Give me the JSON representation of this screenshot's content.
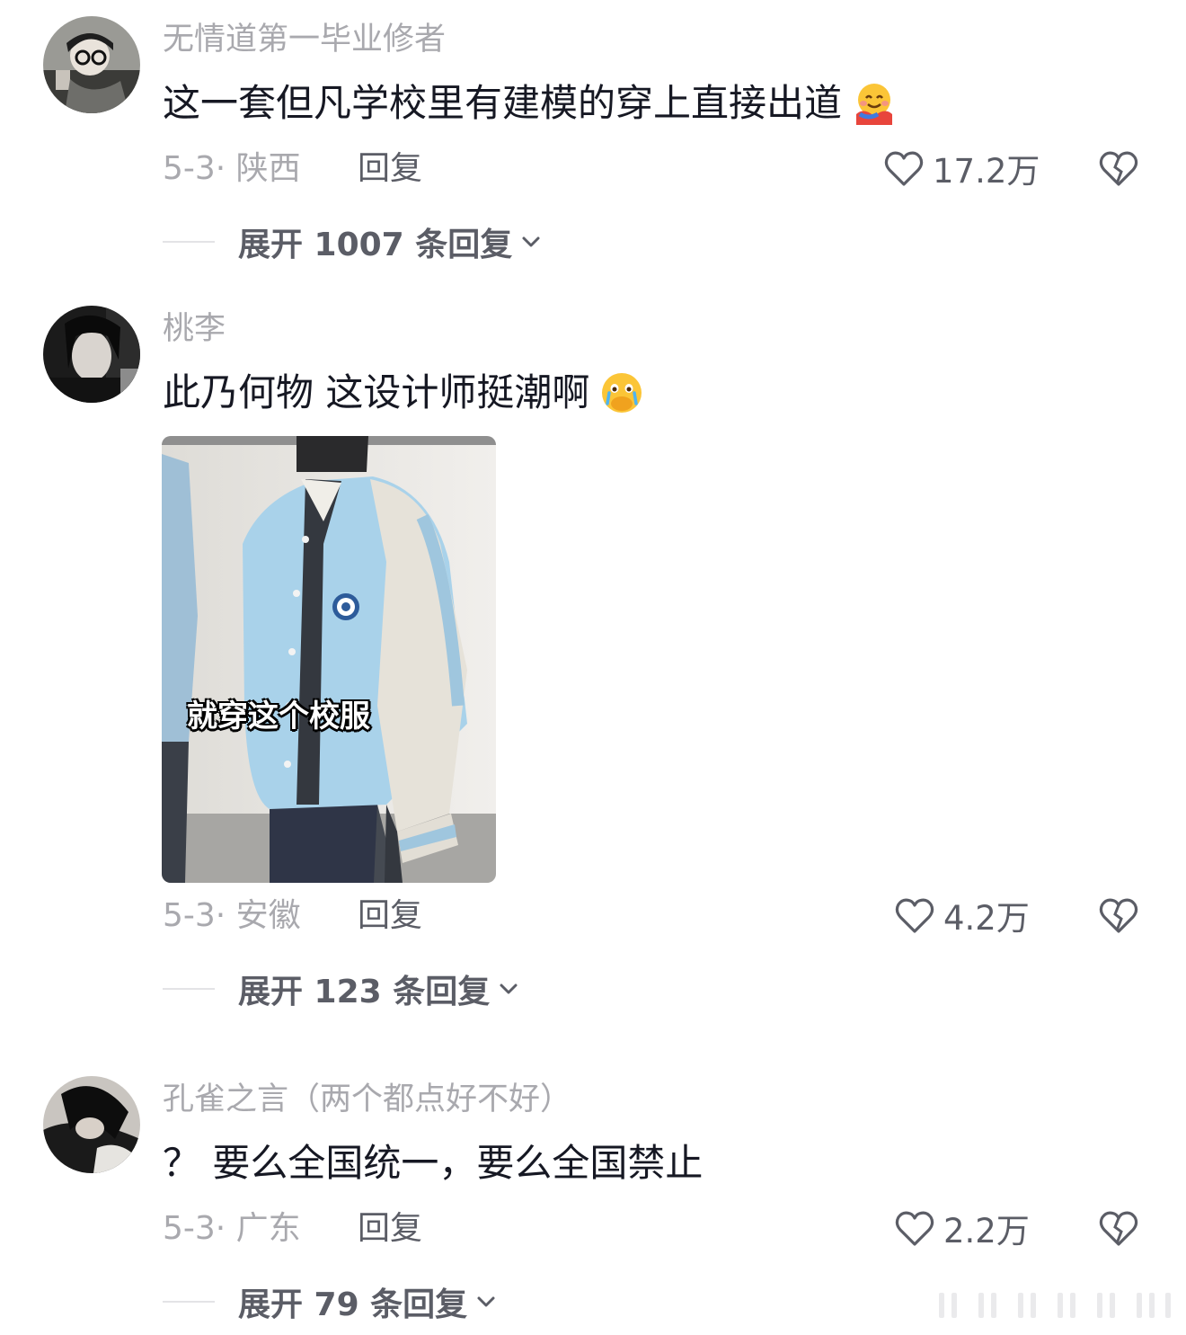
{
  "comments": [
    {
      "username": "无情道第一毕业修者",
      "text": "这一套但凡学校里有建模的穿上直接出道",
      "emoji": "hugging-face-emoji",
      "date_location": "5-3· 陕西",
      "reply_label": "回复",
      "likes": "17.2万",
      "expand_label": "展开 1007 条回复"
    },
    {
      "username": "桃李",
      "text": "此乃何物 这设计师挺潮啊",
      "emoji": "crying-covering-mouth-emoji",
      "image_caption": "就穿这个校服",
      "date_location": "5-3· 安徽",
      "reply_label": "回复",
      "likes": "4.2万",
      "expand_label": "展开 123 条回复"
    },
    {
      "username": "孔雀之言（两个都点好不好）",
      "text": "？ 要么全国统一，要么全国禁止",
      "date_location": "5-3· 广东",
      "reply_label": "回复",
      "likes": "2.2万",
      "expand_label": "展开 79 条回复"
    }
  ],
  "icons": {
    "like": "heart-outline-icon",
    "dislike": "broken-heart-icon",
    "expand": "chevron-down-icon"
  },
  "colors": {
    "username": "#a9a9ae",
    "text": "#161823",
    "secondary": "#5b5d66",
    "jacket_blue": "#a9d2ea"
  }
}
